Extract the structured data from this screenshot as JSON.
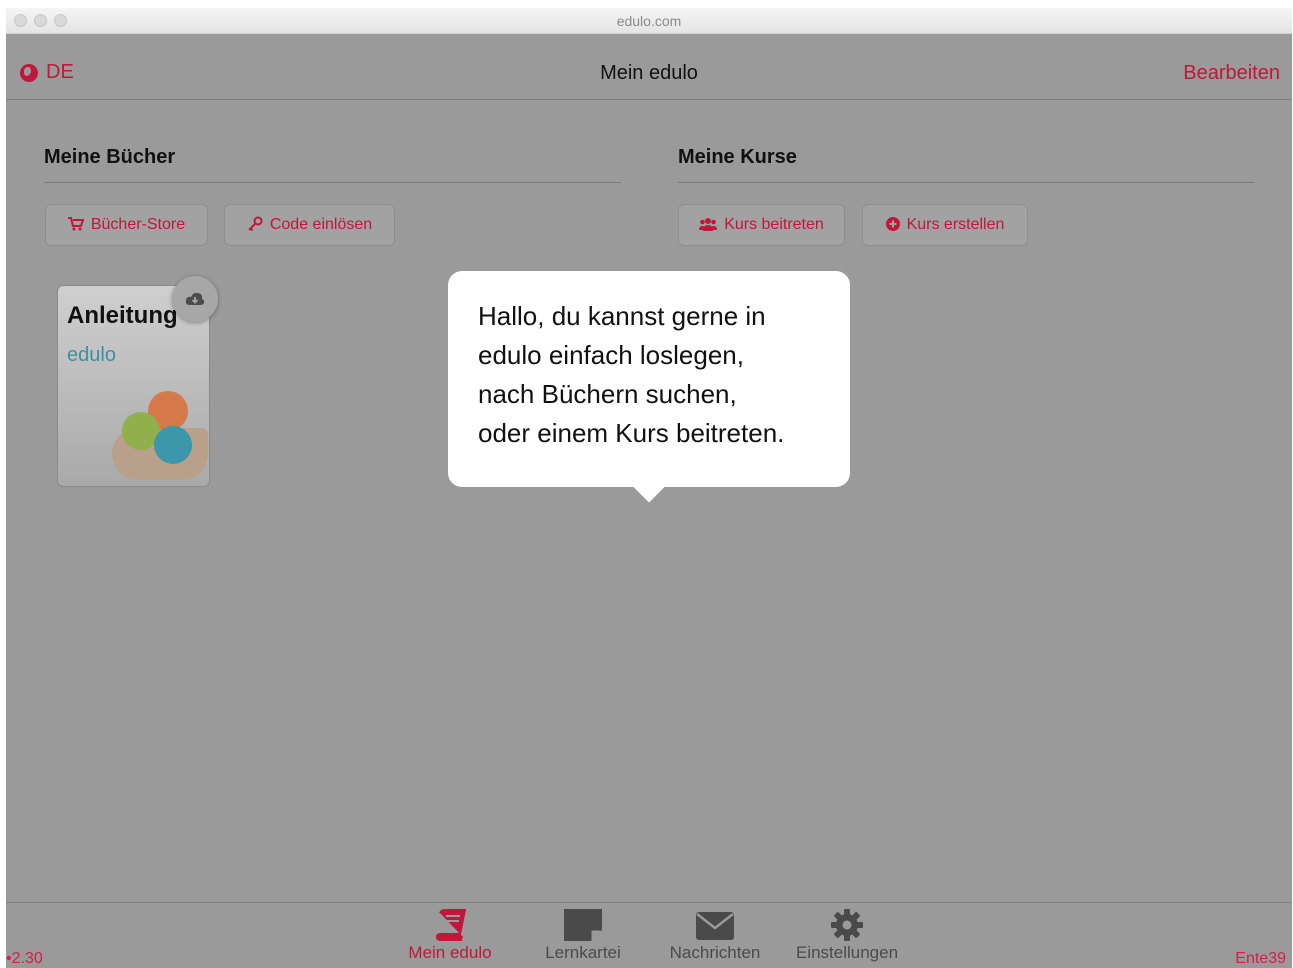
{
  "window": {
    "title": "edulo.com"
  },
  "header": {
    "language_label": "DE",
    "language_icon": "globe-icon",
    "title": "Mein edulo",
    "edit_label": "Bearbeiten"
  },
  "books_section": {
    "title": "Meine Bücher",
    "buttons": [
      {
        "label": "Bücher-Store",
        "icon": "cart-icon"
      },
      {
        "label": "Code einlösen",
        "icon": "key-icon"
      }
    ],
    "books": [
      {
        "title": "Anleitung",
        "brand": "edulo",
        "status_icon": "cloud-download-icon"
      }
    ]
  },
  "courses_section": {
    "title": "Meine Kurse",
    "buttons": [
      {
        "label": "Kurs beitreten",
        "icon": "users-icon"
      },
      {
        "label": "Kurs erstellen",
        "icon": "plus-circle-icon"
      }
    ]
  },
  "tooltip": {
    "text": "Hallo, du kannst gerne in\nedulo einfach loslegen,\nnach Büchern suchen,\noder einem Kurs beitreten."
  },
  "tabbar": {
    "version": "•2.30",
    "user": "Ente39",
    "tabs": [
      {
        "label": "Mein edulo",
        "icon": "book-icon",
        "active": true
      },
      {
        "label": "Lernkartei",
        "icon": "note-card-icon",
        "active": false
      },
      {
        "label": "Nachrichten",
        "icon": "envelope-icon",
        "active": false
      },
      {
        "label": "Einstellungen",
        "icon": "gear-icon",
        "active": false
      }
    ]
  },
  "colors": {
    "accent": "#c2163b",
    "overlay_bg": "#9a9a9a",
    "tooltip_bg": "#ffffff"
  }
}
